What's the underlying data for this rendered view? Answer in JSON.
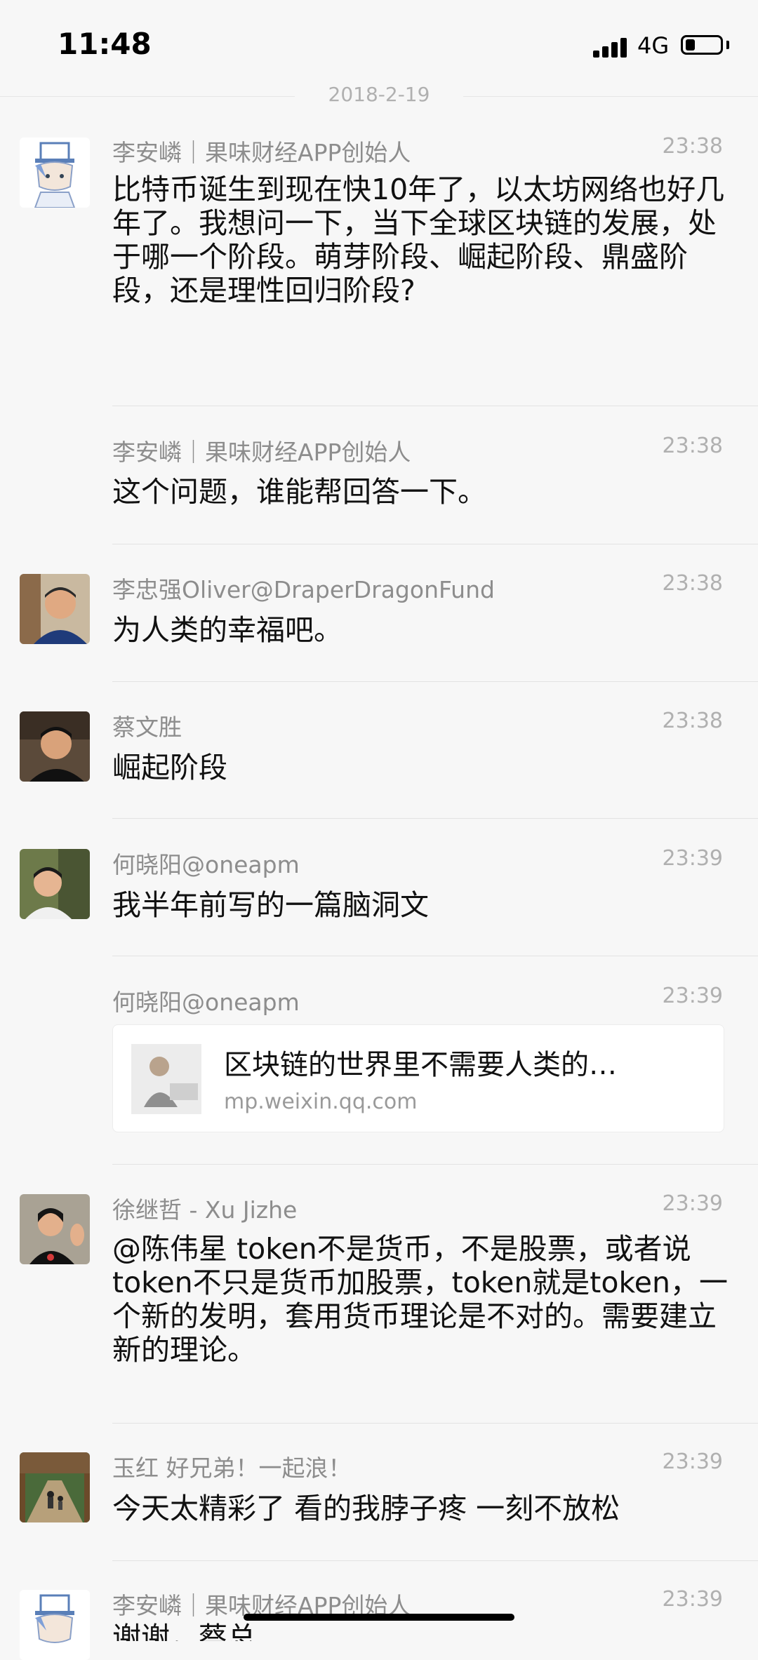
{
  "status_bar": {
    "time": "11:48",
    "network": "4G"
  },
  "date_divider": "2018-2-19",
  "messages": [
    {
      "sender": "李安嶙｜果味财经APP创始人",
      "time": "23:38",
      "text": "比特币诞生到现在快10年了，以太坊网络也好几年了。我想问一下，当下全球区块链的发展，处于哪一个阶段。萌芽阶段、崛起阶段、鼎盛阶段，还是理性回归阶段?"
    },
    {
      "sender": "李安嶙｜果味财经APP创始人",
      "time": "23:38",
      "text": "这个问题，谁能帮回答一下。"
    },
    {
      "sender": "李忠强Oliver@DraperDragonFund",
      "time": "23:38",
      "text": "为人类的幸福吧。"
    },
    {
      "sender": "蔡文胜",
      "time": "23:38",
      "text": "崛起阶段"
    },
    {
      "sender": "何晓阳@oneapm",
      "time": "23:39",
      "text": "我半年前写的一篇脑洞文"
    },
    {
      "sender": "何晓阳@oneapm",
      "time": "23:39",
      "link_title": "区块链的世界里不需要人类的…",
      "link_url": "mp.weixin.qq.com"
    },
    {
      "sender": "徐继哲 - Xu Jizhe",
      "time": "23:39",
      "text": "@陈伟星 token不是货币，不是股票，或者说token不只是货币加股票，token就是token，一个新的发明，套用货币理论是不对的。需要建立新的理论。"
    },
    {
      "sender": "玉红 好兄弟！一起浪！",
      "time": "23:39",
      "text": "今天太精彩了 看的我脖子疼 一刻不放松"
    },
    {
      "sender": "李安嶙｜果味财经APP创始人",
      "time": "23:39",
      "text": "谢谢，蔡总"
    }
  ]
}
